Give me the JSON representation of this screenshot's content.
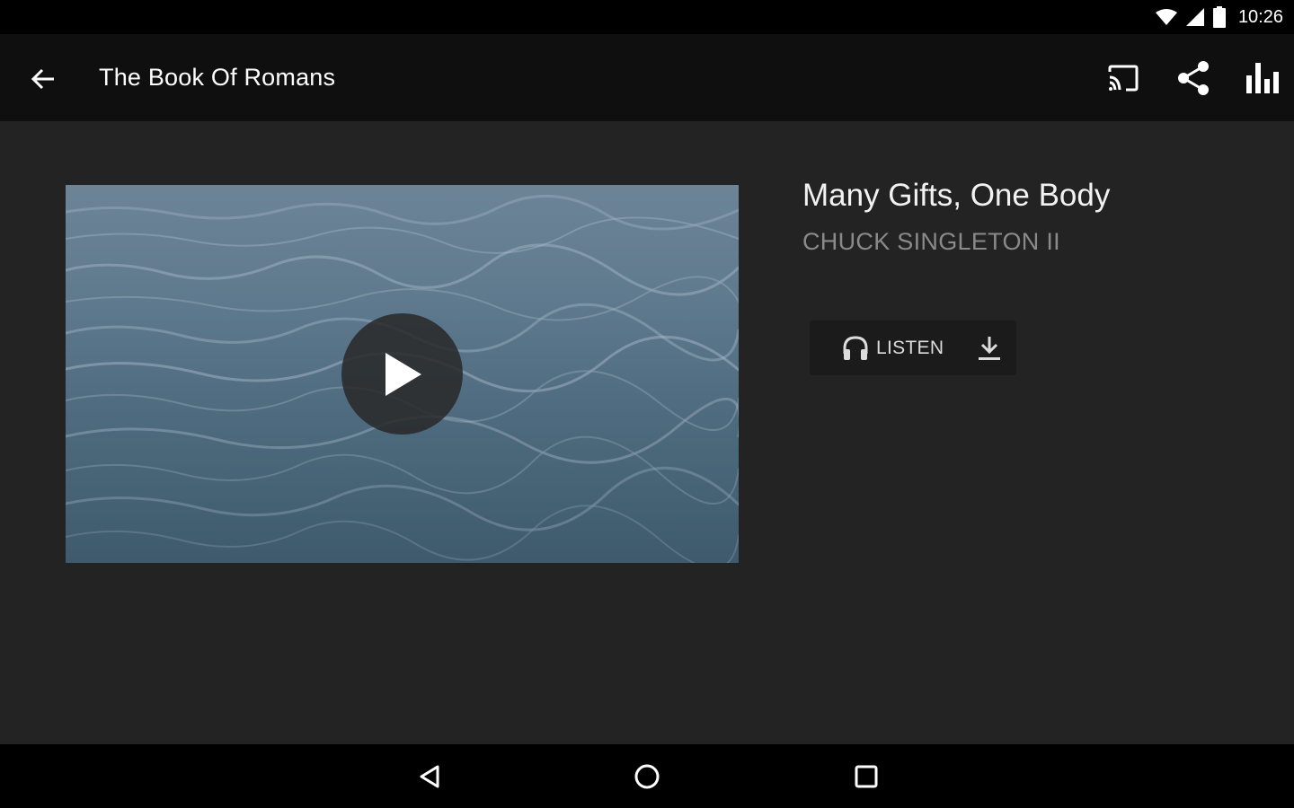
{
  "status_bar": {
    "time": "10:26",
    "icons": [
      "wifi-icon",
      "signal-icon",
      "battery-icon"
    ]
  },
  "app_bar": {
    "title": "The Book Of Romans",
    "back_icon": "arrow-left-icon",
    "actions": [
      "cast-icon",
      "share-icon",
      "bar-chart-icon"
    ]
  },
  "media": {
    "title": "Many Gifts, One Body",
    "speaker": "CHUCK SINGLETON II",
    "listen_label": "LISTEN",
    "listen_icon": "headphones-icon",
    "download_icon": "download-icon",
    "play_icon": "play-icon"
  },
  "nav_bar": {
    "icons": [
      "nav-back-icon",
      "nav-home-icon",
      "nav-recents-icon"
    ]
  },
  "colors": {
    "background": "#232323",
    "app_bar": "#0f0f0f",
    "system_bars": "#000000",
    "speaker_text": "#8a8a8a"
  }
}
